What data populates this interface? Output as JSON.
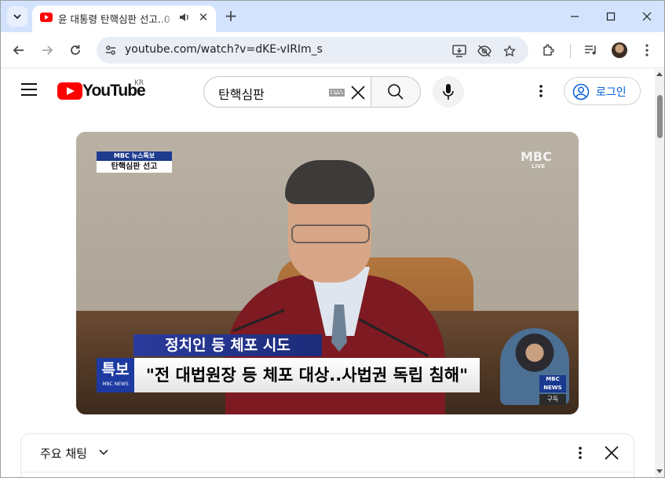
{
  "browser": {
    "tab": {
      "title": "윤 대통령 탄핵심판 선고..0",
      "favicon": "youtube-favicon-icon",
      "audio_icon": "speaker-icon",
      "close_label": "✕"
    },
    "new_tab_label": "+",
    "url": "youtube.com/watch?v=dKE-vIRIm_s",
    "window_controls": {
      "minimize": "—",
      "maximize": "☐",
      "close": "✕"
    }
  },
  "youtube": {
    "brand": "YouTube",
    "country_code": "KR",
    "search": {
      "query": "탄핵심판"
    },
    "signin_label": "로그인",
    "brand_color": "#ff0000",
    "link_color": "#065fd4"
  },
  "video": {
    "badge_top": "MBC 뉴스특보",
    "badge_bottom": "탄핵심판 선고",
    "channel_logo": "MBC",
    "live_label": "LIVE",
    "subtitle_top": "정치인 등 체포 시도",
    "tag_main": "특보",
    "tag_sub": "MBC NEWS",
    "subtitle_main": "\"전 대법원장 등 체포 대상..사법권 독립 침해\"",
    "signer_logo": "MBC NEWS",
    "subscribe_label": "구독"
  },
  "chat": {
    "title": "주요 채팅"
  }
}
